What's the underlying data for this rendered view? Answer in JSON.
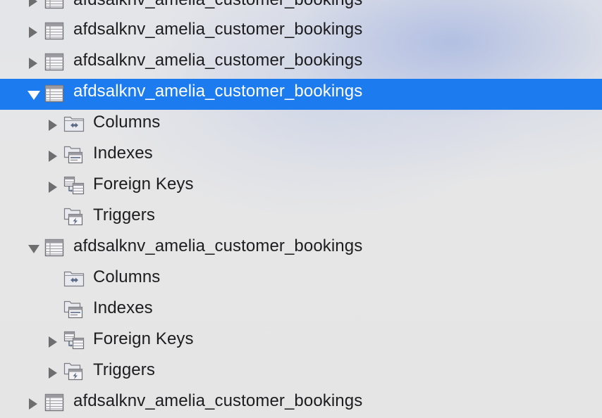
{
  "tree": {
    "nodes": [
      {
        "kind": "table",
        "label": "afdsalknv_amelia_customer_bookings",
        "expanded": false,
        "selected": false,
        "icon": "table-icon"
      },
      {
        "kind": "table",
        "label": "afdsalknv_amelia_customer_bookings",
        "expanded": false,
        "selected": false,
        "icon": "table-icon"
      },
      {
        "kind": "table",
        "label": "afdsalknv_amelia_customer_bookings",
        "expanded": false,
        "selected": false,
        "icon": "table-icon"
      },
      {
        "kind": "table",
        "label": "afdsalknv_amelia_customer_bookings",
        "expanded": true,
        "selected": true,
        "icon": "table-icon"
      },
      {
        "kind": "group",
        "label": "Columns",
        "has_children": true,
        "expanded": false,
        "icon": "columns-folder-icon"
      },
      {
        "kind": "group",
        "label": "Indexes",
        "has_children": true,
        "expanded": false,
        "icon": "indexes-folder-icon"
      },
      {
        "kind": "group",
        "label": "Foreign Keys",
        "has_children": true,
        "expanded": false,
        "icon": "foreign-keys-folder-icon"
      },
      {
        "kind": "group",
        "label": "Triggers",
        "has_children": false,
        "expanded": false,
        "icon": "triggers-folder-icon"
      },
      {
        "kind": "table",
        "label": "afdsalknv_amelia_customer_bookings",
        "expanded": true,
        "selected": false,
        "icon": "table-icon"
      },
      {
        "kind": "group",
        "label": "Columns",
        "has_children": false,
        "expanded": false,
        "icon": "columns-folder-icon"
      },
      {
        "kind": "group",
        "label": "Indexes",
        "has_children": false,
        "expanded": false,
        "icon": "indexes-folder-icon"
      },
      {
        "kind": "group",
        "label": "Foreign Keys",
        "has_children": true,
        "expanded": false,
        "icon": "foreign-keys-folder-icon"
      },
      {
        "kind": "group",
        "label": "Triggers",
        "has_children": true,
        "expanded": false,
        "icon": "triggers-folder-icon"
      },
      {
        "kind": "table",
        "label": "afdsalknv_amelia_customer_bookings",
        "expanded": false,
        "selected": false,
        "icon": "table-icon"
      }
    ]
  },
  "colors": {
    "selection": "#1d7bf0",
    "text": "#1d1d1f",
    "selected_text": "#ffffff",
    "disclosure": "#6e6e70"
  }
}
